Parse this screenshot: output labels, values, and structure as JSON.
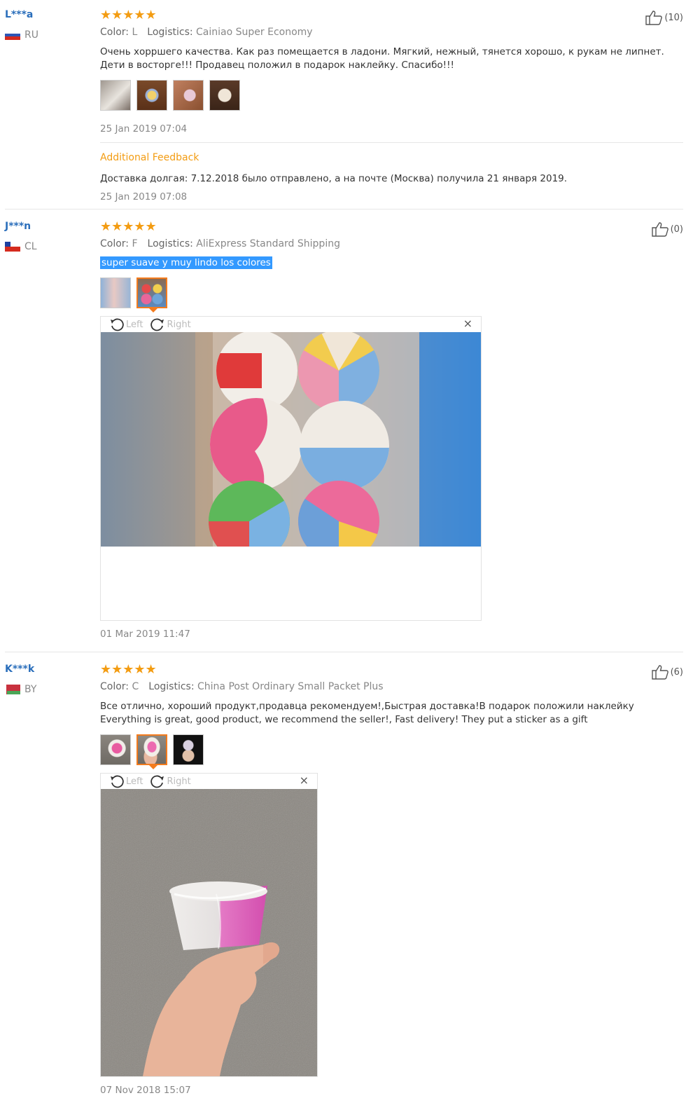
{
  "labels": {
    "color": "Color:",
    "logistics": "Logistics:",
    "left": "Left",
    "right": "Right",
    "close": "×",
    "stars": "★★★★★"
  },
  "reviews": [
    {
      "buyer": "L***a",
      "country": "RU",
      "helpful": "(10)",
      "color": "L",
      "logistics": "Cainiao Super Economy",
      "text": "Очень хорршего качества. Как раз помещается в ладони. Мягкий, нежный, тянется хорошо, к рукам не липнет. Дети в восторге!!! Продавец положил в подарок наклейку. Спасибо!!!",
      "date": "25 Jan 2019 07:04",
      "additional_title": "Additional Feedback",
      "additional_text": "Доставка долгая: 7.12.2018 было отправлено, а на почте (Москва) получила 21 января 2019.",
      "additional_date": "25 Jan 2019 07:08"
    },
    {
      "buyer": "J***n",
      "country": "CL",
      "helpful": "(0)",
      "color": "F",
      "logistics": "AliExpress Standard Shipping",
      "text": "super suave y muy lindo los colores",
      "date": "01 Mar 2019 11:47"
    },
    {
      "buyer": "K***k",
      "country": "BY",
      "helpful": "(6)",
      "color": "C",
      "logistics": "China Post Ordinary Small Packet Plus",
      "text": "Все отлично, хороший продукт,продавца рекомендуем!,Быстрая доставка!В подарок положили наклейку Everything is great, good product, we recommend the seller!, Fast delivery! They put a sticker as a gift",
      "date": "07 Nov 2018 15:07"
    }
  ],
  "colors": {
    "stars": "#f39c12",
    "buyer": "#2a6ebb",
    "additional": "#f39c12",
    "highlight": "#3399ff",
    "selected_thumb": "#f37b1d"
  }
}
